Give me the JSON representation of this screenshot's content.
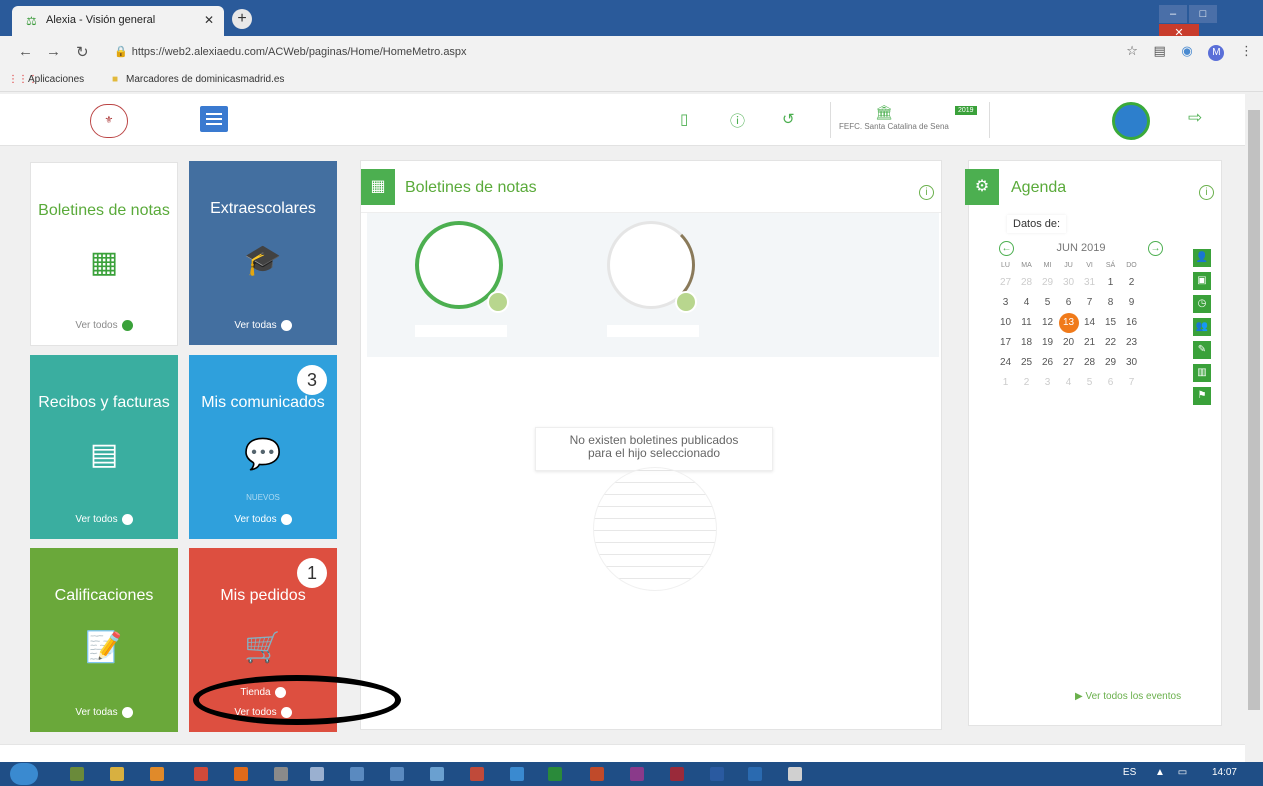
{
  "browser": {
    "tab_title": "Alexia - Visión general",
    "url": "https://web2.alexiaedu.com/ACWeb/paginas/Home/HomeMetro.aspx",
    "bookmarks": [
      "Aplicaciones",
      "Marcadores de dominicasmadrid.es"
    ],
    "profile_initial": "M"
  },
  "header": {
    "school_name": "FEFC. Santa Catalina de Sena",
    "year_badge": "2019"
  },
  "tiles": {
    "boletines": {
      "title": "Boletines de notas",
      "link": "Ver todos"
    },
    "extraescolares": {
      "title": "Extraescolares",
      "link": "Ver todas"
    },
    "recibos": {
      "title": "Recibos y facturas",
      "link": "Ver todos"
    },
    "comunicados": {
      "title": "Mis comunicados",
      "badge": "3",
      "sub": "NUEVOS",
      "link": "Ver todos"
    },
    "calificaciones": {
      "title": "Calificaciones",
      "link": "Ver todas"
    },
    "pedidos": {
      "title": "Mis pedidos",
      "badge": "1",
      "shop": "Tienda",
      "link": "Ver todos"
    }
  },
  "boletines_panel": {
    "title": "Boletines de notas",
    "empty_message_line1": "No existen boletines publicados",
    "empty_message_line2": "para el hijo seleccionado"
  },
  "agenda": {
    "title": "Agenda",
    "datos_label": "Datos de:",
    "month": "JUN 2019",
    "day_names": [
      "LU",
      "MA",
      "MI",
      "JU",
      "VI",
      "SÁ",
      "DO"
    ],
    "weeks": [
      [
        "27",
        "28",
        "29",
        "30",
        "31",
        "1",
        "2"
      ],
      [
        "3",
        "4",
        "5",
        "6",
        "7",
        "8",
        "9"
      ],
      [
        "10",
        "11",
        "12",
        "13",
        "14",
        "15",
        "16"
      ],
      [
        "17",
        "18",
        "19",
        "20",
        "21",
        "22",
        "23"
      ],
      [
        "24",
        "25",
        "26",
        "27",
        "28",
        "29",
        "30"
      ],
      [
        "1",
        "2",
        "3",
        "4",
        "5",
        "6",
        "7"
      ]
    ],
    "today": "13",
    "view_all_events": "Ver todos los eventos"
  },
  "taskbar": {
    "language": "ES",
    "time": "14:07"
  }
}
